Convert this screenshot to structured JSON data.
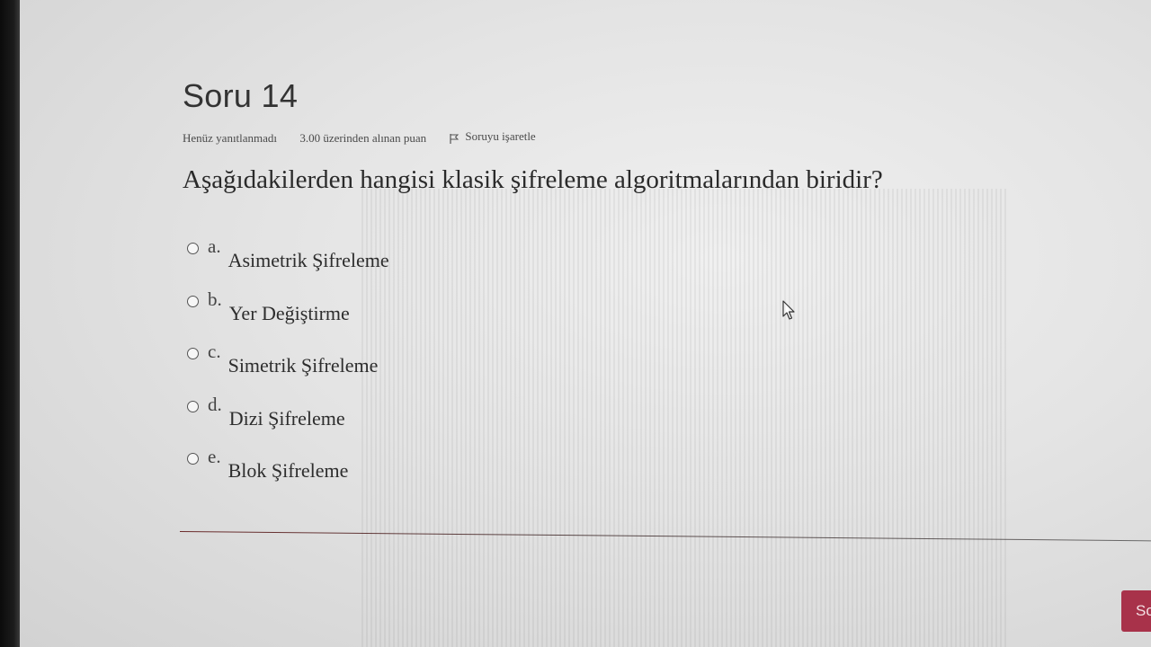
{
  "question": {
    "title": "Soru 14",
    "status": "Henüz yanıtlanmadı",
    "grade": "3.00 üzerinden alınan puan",
    "flag_label": "Soruyu işaretle",
    "text": "Aşağıdakilerden hangisi klasik şifreleme algoritmalarından biridir?"
  },
  "answers": [
    {
      "letter": "a.",
      "text": "Asimetrik Şifreleme"
    },
    {
      "letter": "b.",
      "text": "Yer Değiştirme"
    },
    {
      "letter": "c.",
      "text": "Simetrik Şifreleme"
    },
    {
      "letter": "d.",
      "text": "Dizi Şifreleme"
    },
    {
      "letter": "e.",
      "text": "Blok Şifreleme"
    }
  ],
  "next_button": {
    "label": "Sc"
  },
  "icons": {
    "flag": "flag-icon",
    "cursor": "mouse-pointer-icon"
  },
  "colors": {
    "accent": "#a8324a",
    "divider": "#6b2a2a"
  }
}
